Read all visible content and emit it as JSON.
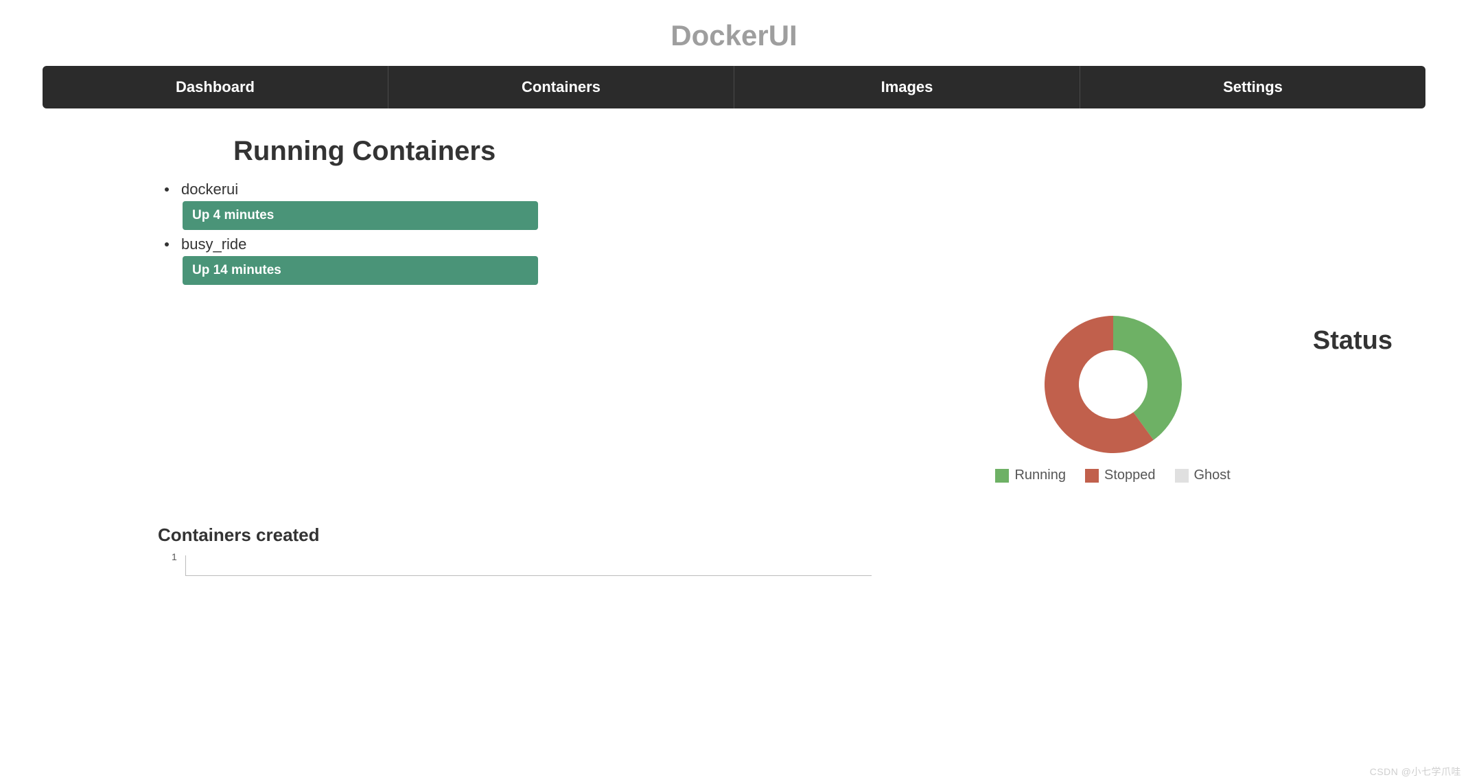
{
  "header": {
    "title": "DockerUI"
  },
  "nav": {
    "items": [
      {
        "label": "Dashboard"
      },
      {
        "label": "Containers"
      },
      {
        "label": "Images"
      },
      {
        "label": "Settings"
      }
    ]
  },
  "running": {
    "heading": "Running Containers",
    "containers": [
      {
        "name": "dockerui",
        "status": "Up 4 minutes"
      },
      {
        "name": "busy_ride",
        "status": "Up 14 minutes"
      }
    ]
  },
  "status": {
    "heading": "Status",
    "legend": [
      {
        "label": "Running",
        "color": "#6eb165"
      },
      {
        "label": "Stopped",
        "color": "#c1604c"
      },
      {
        "label": "Ghost",
        "color": "#e0e0e0"
      }
    ]
  },
  "chart_data": {
    "type": "pie",
    "title": "Status",
    "series": [
      {
        "name": "Running",
        "value": 2,
        "color": "#6eb165"
      },
      {
        "name": "Stopped",
        "value": 3,
        "color": "#c1604c"
      },
      {
        "name": "Ghost",
        "value": 0,
        "color": "#e0e0e0"
      }
    ],
    "donut": true
  },
  "created": {
    "heading": "Containers created",
    "y_tick": "1"
  },
  "watermark": "CSDN @小七学爪哇"
}
